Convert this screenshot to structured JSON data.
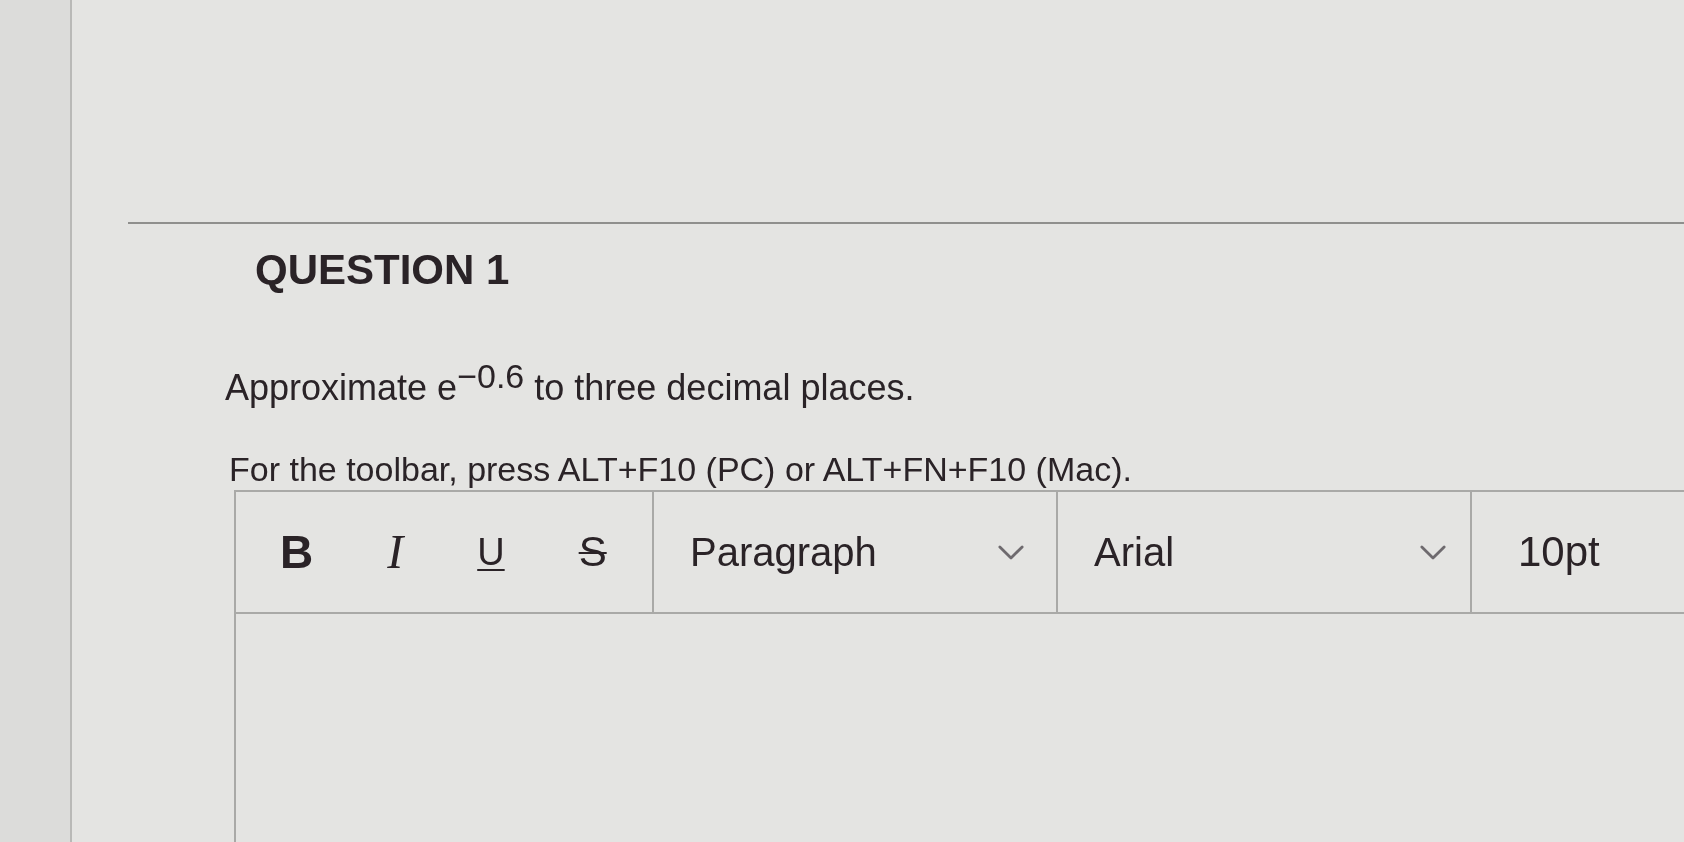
{
  "question": {
    "title": "QUESTION 1",
    "prompt": "Approximate e$^{−0.6}$ to three decimal places.",
    "hint": "For the toolbar, press ALT+F10 (PC) or ALT+FN+F10 (Mac)."
  },
  "editor": {
    "format_buttons": [
      {
        "label": "B",
        "kind": "bold"
      },
      {
        "label": "I",
        "kind": "italic"
      },
      {
        "label": "U",
        "kind": "underline"
      },
      {
        "label": "S",
        "kind": "strikethrough"
      }
    ],
    "dropdowns": [
      {
        "value": "Paragraph"
      },
      {
        "value": "Arial"
      }
    ],
    "font_size": "10pt"
  }
}
